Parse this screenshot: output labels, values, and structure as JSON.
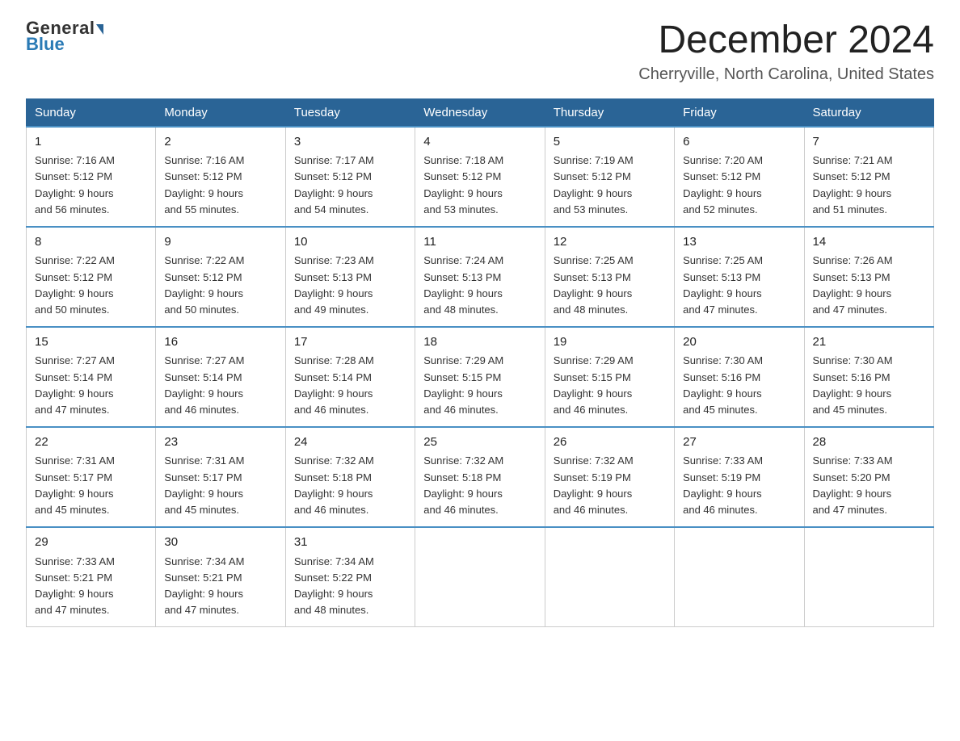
{
  "header": {
    "logo_top": "General",
    "logo_bottom": "Blue",
    "month_title": "December 2024",
    "location": "Cherryville, North Carolina, United States"
  },
  "weekdays": [
    "Sunday",
    "Monday",
    "Tuesday",
    "Wednesday",
    "Thursday",
    "Friday",
    "Saturday"
  ],
  "weeks": [
    [
      {
        "day": "1",
        "sunrise": "7:16 AM",
        "sunset": "5:12 PM",
        "daylight": "9 hours and 56 minutes."
      },
      {
        "day": "2",
        "sunrise": "7:16 AM",
        "sunset": "5:12 PM",
        "daylight": "9 hours and 55 minutes."
      },
      {
        "day": "3",
        "sunrise": "7:17 AM",
        "sunset": "5:12 PM",
        "daylight": "9 hours and 54 minutes."
      },
      {
        "day": "4",
        "sunrise": "7:18 AM",
        "sunset": "5:12 PM",
        "daylight": "9 hours and 53 minutes."
      },
      {
        "day": "5",
        "sunrise": "7:19 AM",
        "sunset": "5:12 PM",
        "daylight": "9 hours and 53 minutes."
      },
      {
        "day": "6",
        "sunrise": "7:20 AM",
        "sunset": "5:12 PM",
        "daylight": "9 hours and 52 minutes."
      },
      {
        "day": "7",
        "sunrise": "7:21 AM",
        "sunset": "5:12 PM",
        "daylight": "9 hours and 51 minutes."
      }
    ],
    [
      {
        "day": "8",
        "sunrise": "7:22 AM",
        "sunset": "5:12 PM",
        "daylight": "9 hours and 50 minutes."
      },
      {
        "day": "9",
        "sunrise": "7:22 AM",
        "sunset": "5:12 PM",
        "daylight": "9 hours and 50 minutes."
      },
      {
        "day": "10",
        "sunrise": "7:23 AM",
        "sunset": "5:13 PM",
        "daylight": "9 hours and 49 minutes."
      },
      {
        "day": "11",
        "sunrise": "7:24 AM",
        "sunset": "5:13 PM",
        "daylight": "9 hours and 48 minutes."
      },
      {
        "day": "12",
        "sunrise": "7:25 AM",
        "sunset": "5:13 PM",
        "daylight": "9 hours and 48 minutes."
      },
      {
        "day": "13",
        "sunrise": "7:25 AM",
        "sunset": "5:13 PM",
        "daylight": "9 hours and 47 minutes."
      },
      {
        "day": "14",
        "sunrise": "7:26 AM",
        "sunset": "5:13 PM",
        "daylight": "9 hours and 47 minutes."
      }
    ],
    [
      {
        "day": "15",
        "sunrise": "7:27 AM",
        "sunset": "5:14 PM",
        "daylight": "9 hours and 47 minutes."
      },
      {
        "day": "16",
        "sunrise": "7:27 AM",
        "sunset": "5:14 PM",
        "daylight": "9 hours and 46 minutes."
      },
      {
        "day": "17",
        "sunrise": "7:28 AM",
        "sunset": "5:14 PM",
        "daylight": "9 hours and 46 minutes."
      },
      {
        "day": "18",
        "sunrise": "7:29 AM",
        "sunset": "5:15 PM",
        "daylight": "9 hours and 46 minutes."
      },
      {
        "day": "19",
        "sunrise": "7:29 AM",
        "sunset": "5:15 PM",
        "daylight": "9 hours and 46 minutes."
      },
      {
        "day": "20",
        "sunrise": "7:30 AM",
        "sunset": "5:16 PM",
        "daylight": "9 hours and 45 minutes."
      },
      {
        "day": "21",
        "sunrise": "7:30 AM",
        "sunset": "5:16 PM",
        "daylight": "9 hours and 45 minutes."
      }
    ],
    [
      {
        "day": "22",
        "sunrise": "7:31 AM",
        "sunset": "5:17 PM",
        "daylight": "9 hours and 45 minutes."
      },
      {
        "day": "23",
        "sunrise": "7:31 AM",
        "sunset": "5:17 PM",
        "daylight": "9 hours and 45 minutes."
      },
      {
        "day": "24",
        "sunrise": "7:32 AM",
        "sunset": "5:18 PM",
        "daylight": "9 hours and 46 minutes."
      },
      {
        "day": "25",
        "sunrise": "7:32 AM",
        "sunset": "5:18 PM",
        "daylight": "9 hours and 46 minutes."
      },
      {
        "day": "26",
        "sunrise": "7:32 AM",
        "sunset": "5:19 PM",
        "daylight": "9 hours and 46 minutes."
      },
      {
        "day": "27",
        "sunrise": "7:33 AM",
        "sunset": "5:19 PM",
        "daylight": "9 hours and 46 minutes."
      },
      {
        "day": "28",
        "sunrise": "7:33 AM",
        "sunset": "5:20 PM",
        "daylight": "9 hours and 47 minutes."
      }
    ],
    [
      {
        "day": "29",
        "sunrise": "7:33 AM",
        "sunset": "5:21 PM",
        "daylight": "9 hours and 47 minutes."
      },
      {
        "day": "30",
        "sunrise": "7:34 AM",
        "sunset": "5:21 PM",
        "daylight": "9 hours and 47 minutes."
      },
      {
        "day": "31",
        "sunrise": "7:34 AM",
        "sunset": "5:22 PM",
        "daylight": "9 hours and 48 minutes."
      },
      null,
      null,
      null,
      null
    ]
  ],
  "labels": {
    "sunrise": "Sunrise:",
    "sunset": "Sunset:",
    "daylight": "Daylight:"
  }
}
